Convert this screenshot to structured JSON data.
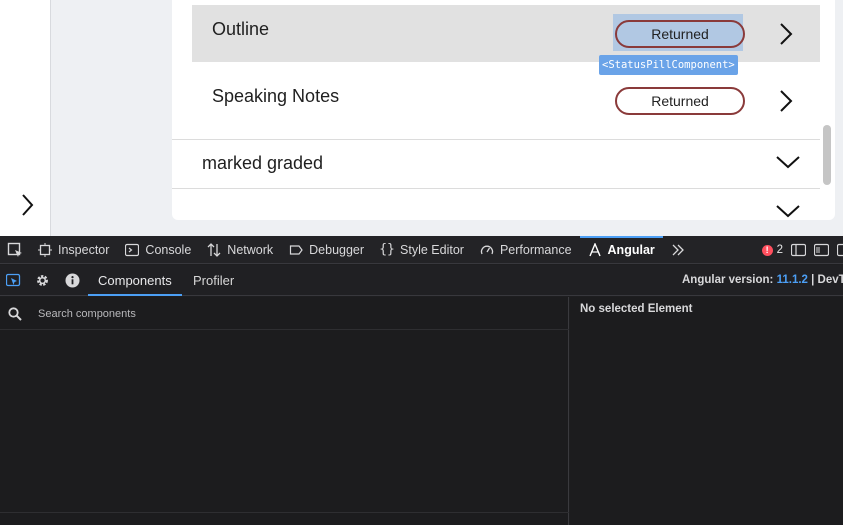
{
  "page": {
    "rows": [
      {
        "title": "Outline",
        "status": "Returned",
        "highlighted": true
      },
      {
        "title": "Speaking Notes",
        "status": "Returned",
        "highlighted": false
      }
    ],
    "component_tag": "<StatusPillComponent>",
    "sections": [
      {
        "title": "marked graded"
      },
      {
        "title": ""
      }
    ]
  },
  "devtools": {
    "tabs": [
      {
        "label": "Inspector",
        "icon": "inspector-icon"
      },
      {
        "label": "Console",
        "icon": "console-icon"
      },
      {
        "label": "Network",
        "icon": "network-icon"
      },
      {
        "label": "Debugger",
        "icon": "debugger-icon"
      },
      {
        "label": "Style Editor",
        "icon": "style-editor-icon"
      },
      {
        "label": "Performance",
        "icon": "performance-icon"
      },
      {
        "label": "Angular",
        "icon": "angular-icon",
        "active": true
      }
    ],
    "error_count": "2"
  },
  "angular": {
    "tabs": [
      "Components",
      "Profiler"
    ],
    "version_label": "Angular version:",
    "version": "11.1.2",
    "version_suffix": "| DevTo",
    "search_placeholder": "Search components",
    "no_selection": "No selected Element"
  },
  "colors": {
    "accent": "#4c9ff5",
    "pill_border": "#8a3a3a",
    "error": "#ff4f5e"
  }
}
